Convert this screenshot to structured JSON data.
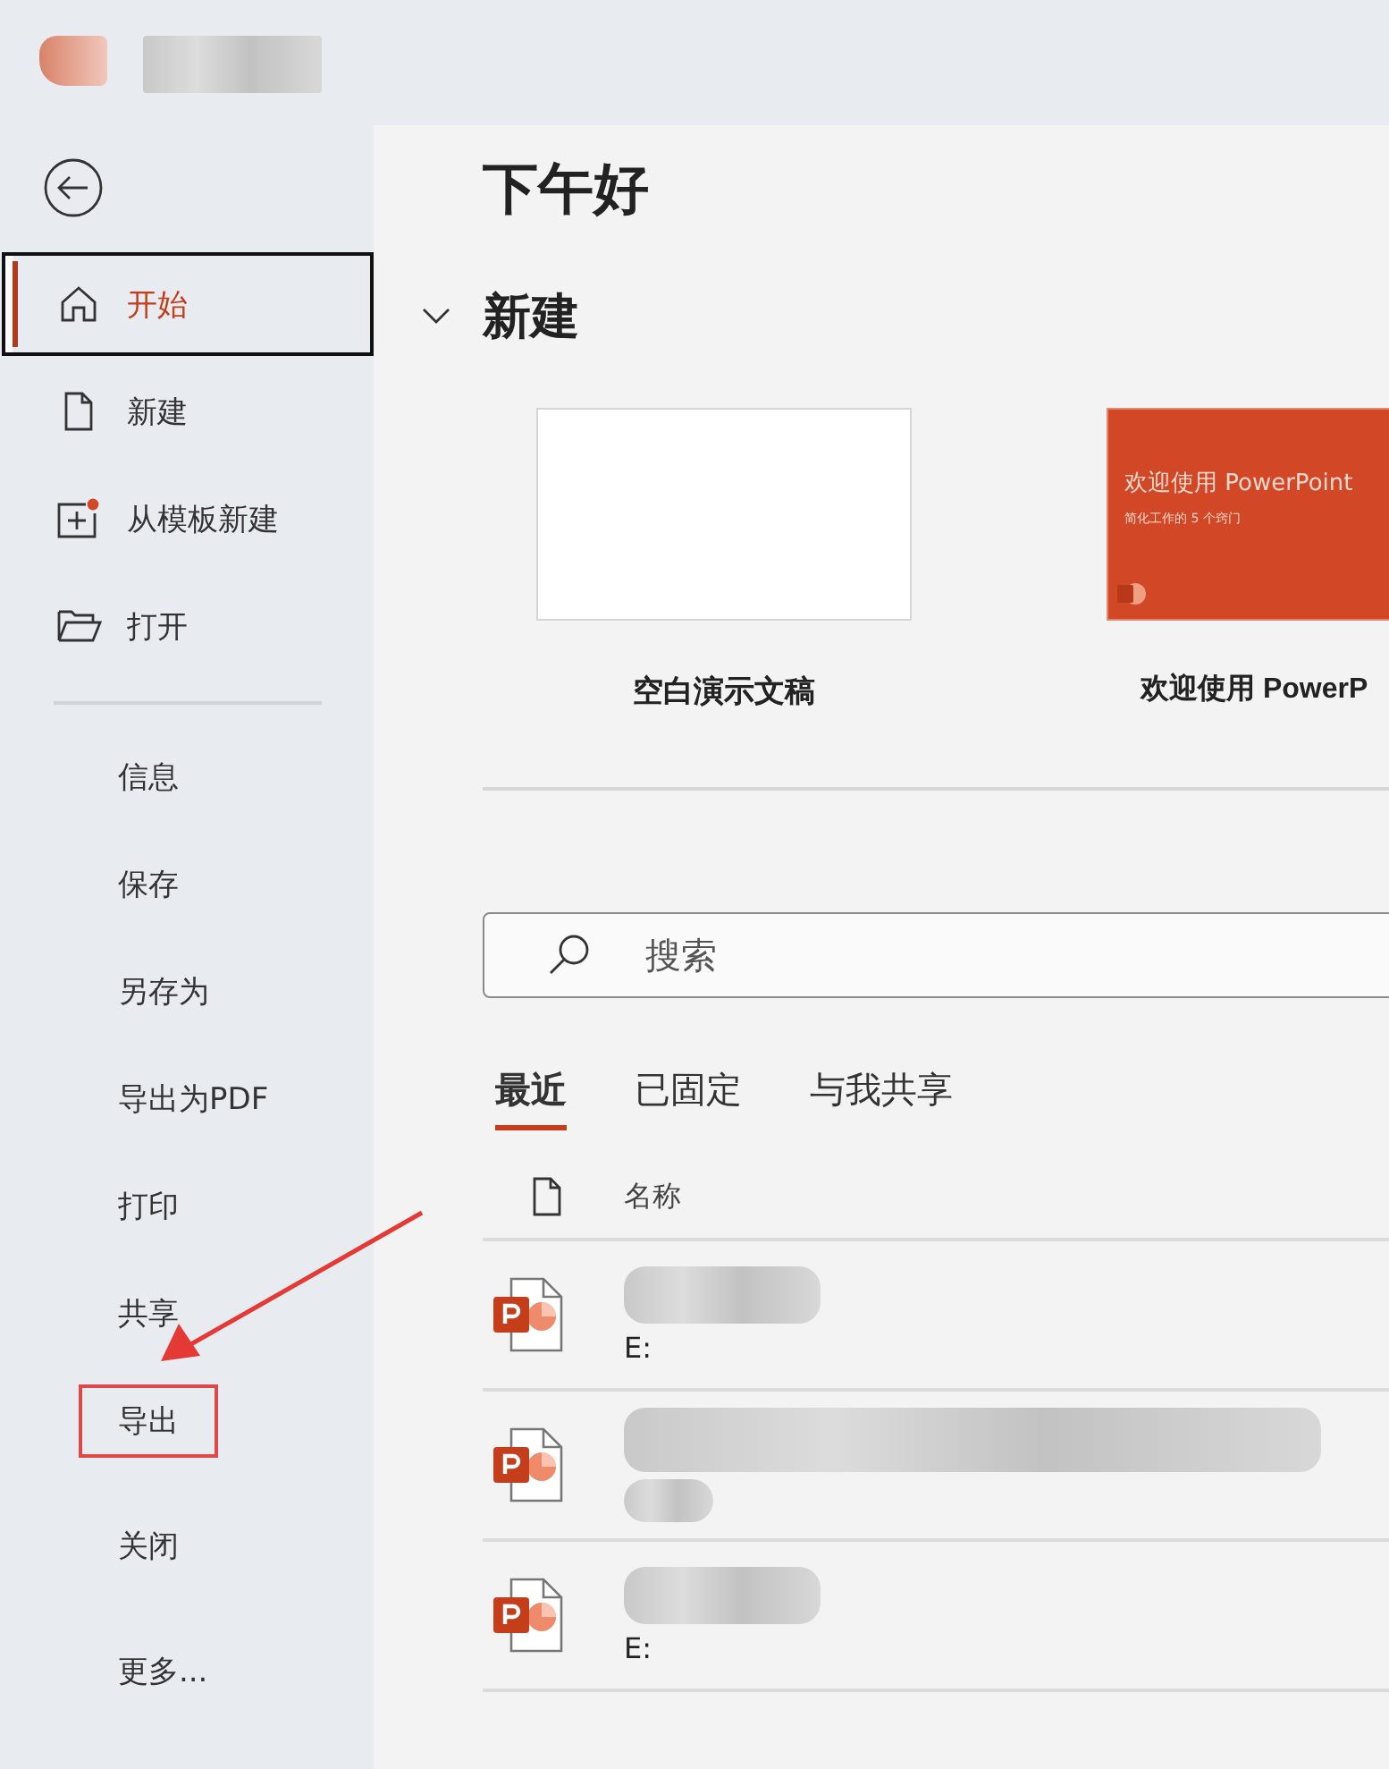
{
  "account": {
    "redacted": true
  },
  "sidebar": {
    "primary": [
      {
        "label": "开始",
        "selected": true
      },
      {
        "label": "新建",
        "selected": false
      },
      {
        "label": "从模板新建",
        "selected": false
      },
      {
        "label": "打开",
        "selected": false
      }
    ],
    "secondary": [
      {
        "label": "信息",
        "highlighted": false
      },
      {
        "label": "保存",
        "highlighted": false
      },
      {
        "label": "另存为",
        "highlighted": false
      },
      {
        "label": "导出为PDF",
        "highlighted": false
      },
      {
        "label": "打印",
        "highlighted": false
      },
      {
        "label": "共享",
        "highlighted": false
      },
      {
        "label": "导出",
        "highlighted": true
      },
      {
        "label": "关闭",
        "highlighted": false
      },
      {
        "label": "更多...",
        "highlighted": false
      }
    ]
  },
  "greeting": "下午好",
  "new_section": {
    "title": "新建",
    "expanded": true,
    "templates": [
      {
        "kind": "blank",
        "label": "空白演示文稿"
      },
      {
        "kind": "welcome",
        "label": "欢迎使用 PowerP",
        "thumb_title": "欢迎使用 PowerPoint",
        "thumb_subtitle": "简化工作的 5 个窍门"
      }
    ]
  },
  "search": {
    "placeholder": "搜索"
  },
  "tabs": [
    {
      "label": "最近",
      "selected": true
    },
    {
      "label": "已固定",
      "selected": false
    },
    {
      "label": "与我共享",
      "selected": false
    }
  ],
  "files": {
    "column": "名称",
    "rows": [
      {
        "kind": "short",
        "path": "E:"
      },
      {
        "kind": "long"
      },
      {
        "kind": "short",
        "path": "E:"
      }
    ]
  }
}
